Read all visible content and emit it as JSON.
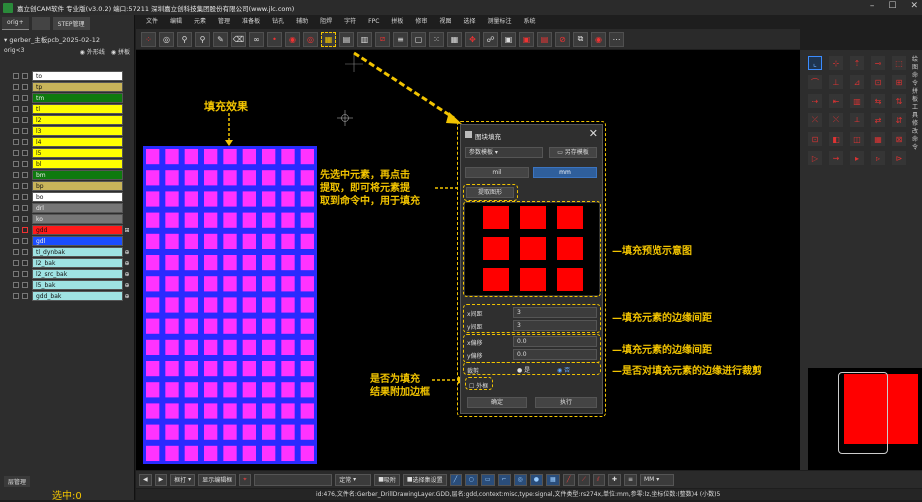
{
  "app": {
    "title": "嘉立创CAM软件 专业版(v3.0.2) 端口:57211    深圳嘉立创科技集团股份有限公司(www.jlc.com)",
    "menu": [
      "文件",
      "编辑",
      "元素",
      "管理",
      "准备板",
      "钻孔",
      "辅助",
      "阻焊",
      "字符",
      "FPC",
      "拼板",
      "修审",
      "视图",
      "选择",
      "测量标注",
      "系统"
    ]
  },
  "left_panel": {
    "tabs": [
      "orig+",
      "",
      "STEP管理"
    ],
    "file": "gerber_主板pcb_2025-02-12",
    "step": "orig<3",
    "opt_outline": "外形线",
    "opt_panel": "拼板",
    "layers": [
      {
        "name": "to",
        "color": "#ffffff"
      },
      {
        "name": "tp",
        "color": "#c8b45a"
      },
      {
        "name": "tm",
        "color": "#0e7a0e"
      },
      {
        "name": "tl",
        "color": "#ffff00"
      },
      {
        "name": "l2",
        "color": "#ffff00"
      },
      {
        "name": "l3",
        "color": "#ffff00"
      },
      {
        "name": "l4",
        "color": "#ffff00"
      },
      {
        "name": "l5",
        "color": "#ffff00"
      },
      {
        "name": "bl",
        "color": "#ffff00"
      },
      {
        "name": "bm",
        "color": "#0e7a0e"
      },
      {
        "name": "bp",
        "color": "#c8b45a"
      },
      {
        "name": "bo",
        "color": "#ffffff"
      },
      {
        "name": "drl",
        "color": "#777777"
      },
      {
        "name": "ko",
        "color": "#777777"
      },
      {
        "name": "gdd",
        "color": "#ff1a1a"
      },
      {
        "name": "gdl",
        "color": "#1a4dff"
      },
      {
        "name": "tl_dynbak",
        "color": "#9fe3e3"
      },
      {
        "name": "l2_bak",
        "color": "#9fe3e3"
      },
      {
        "name": "l2_src_bak",
        "color": "#9fe3e3"
      },
      {
        "name": "l5_bak",
        "color": "#9fe3e3"
      },
      {
        "name": "gdd_bak",
        "color": "#9fe3e3"
      }
    ],
    "bottom_tab": "层管理",
    "selected": "选中:0"
  },
  "canvas": {
    "fill_label": "填充效果",
    "grid_cols": 9,
    "grid_rows": 15,
    "cell_color": "#ff33ff",
    "bg_color": "#2a2aff"
  },
  "dialog": {
    "title": "图块填充",
    "param_template": "参数模板",
    "save_template": "另存模板",
    "unit_mil": "mil",
    "unit_mm": "mm",
    "extract_button": "提取图形",
    "x_gap_label": "x间距",
    "x_gap_value": "3",
    "y_gap_label": "y间距",
    "y_gap_value": "3",
    "x_offset_label": "x偏移",
    "x_offset_value": "0.0",
    "y_offset_label": "y偏移",
    "y_offset_value": "0.0",
    "clip_label": "裁剪",
    "clip_yes": "是",
    "clip_no": "否",
    "border_label": "外框",
    "ok_button": "确定",
    "apply_button": "执行"
  },
  "annotations": {
    "select_hint": [
      "先选中元素，再点击",
      "提取，即可将元素提",
      "取到命令中，用于填充"
    ],
    "preview_hint": "填充预览示意图",
    "gap_hint": "填充元素的边缘间距",
    "offset_hint": "填充元素的边缘间距",
    "clip_hint": "是否对填充元素的边缘进行裁剪",
    "border_hint": [
      "是否为填充",
      "结果附加边框"
    ]
  },
  "bottom_bar": {
    "mode": "框打",
    "display": "显示编辑框",
    "select_mode": "定常",
    "route": "吸附",
    "filter": "选择集设置",
    "unit": "MM"
  },
  "status": "id:476,文件名:Gerber_DrillDrawingLayer.GDD,层名:gdd,context:misc,type:signal,文件类型:rs274x,单位:mm,参零:lz,坐标位数:(整数)4 (小数)5",
  "colors": {
    "accent": "#f2c400",
    "red": "#ff0000",
    "magenta": "#ff33ff",
    "blue": "#2a2aff"
  }
}
